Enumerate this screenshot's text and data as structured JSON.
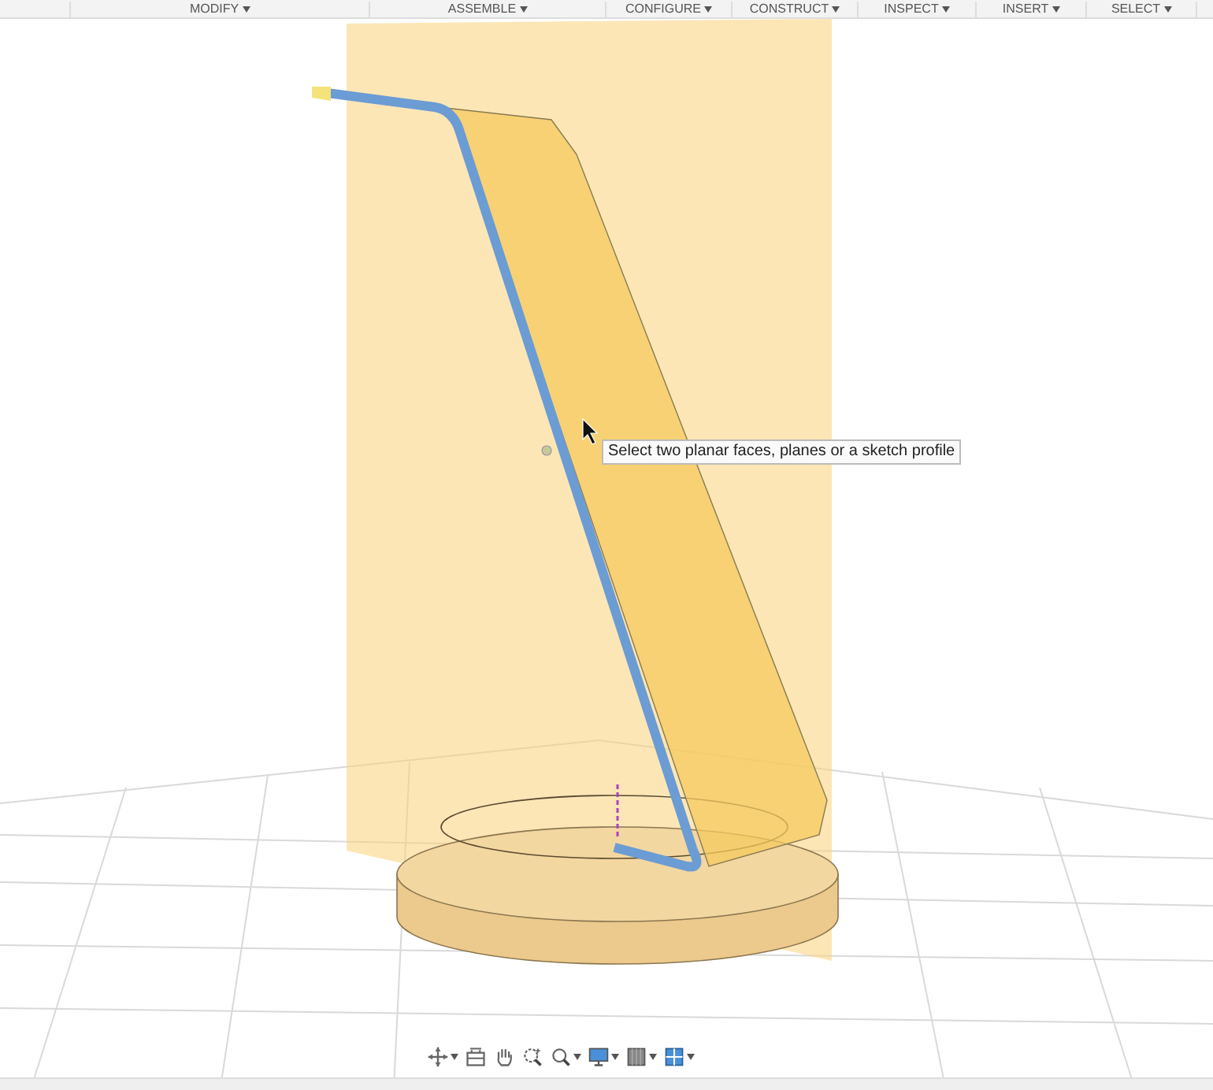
{
  "toolbar": {
    "menus": [
      {
        "label": "MODIFY",
        "dropdown": true
      },
      {
        "label": "ASSEMBLE",
        "dropdown": true
      },
      {
        "label": "CONFIGURE",
        "dropdown": true
      },
      {
        "label": "CONSTRUCT",
        "dropdown": true
      },
      {
        "label": "INSPECT",
        "dropdown": true
      },
      {
        "label": "INSERT",
        "dropdown": true
      },
      {
        "label": "SELECT",
        "dropdown": true
      }
    ]
  },
  "viewport": {
    "tooltip": "Select two planar faces, planes or a sketch profile"
  },
  "navigation_bar": {
    "tools": [
      {
        "kind": "orbit",
        "dropdown": true
      },
      {
        "kind": "look_at",
        "dropdown": false
      },
      {
        "kind": "pan",
        "dropdown": false
      },
      {
        "kind": "zoom_window",
        "dropdown": false
      },
      {
        "kind": "zoom",
        "dropdown": true
      },
      {
        "kind": "display",
        "dropdown": true
      },
      {
        "kind": "visual_style",
        "dropdown": true
      },
      {
        "kind": "viewports",
        "dropdown": true
      }
    ]
  }
}
